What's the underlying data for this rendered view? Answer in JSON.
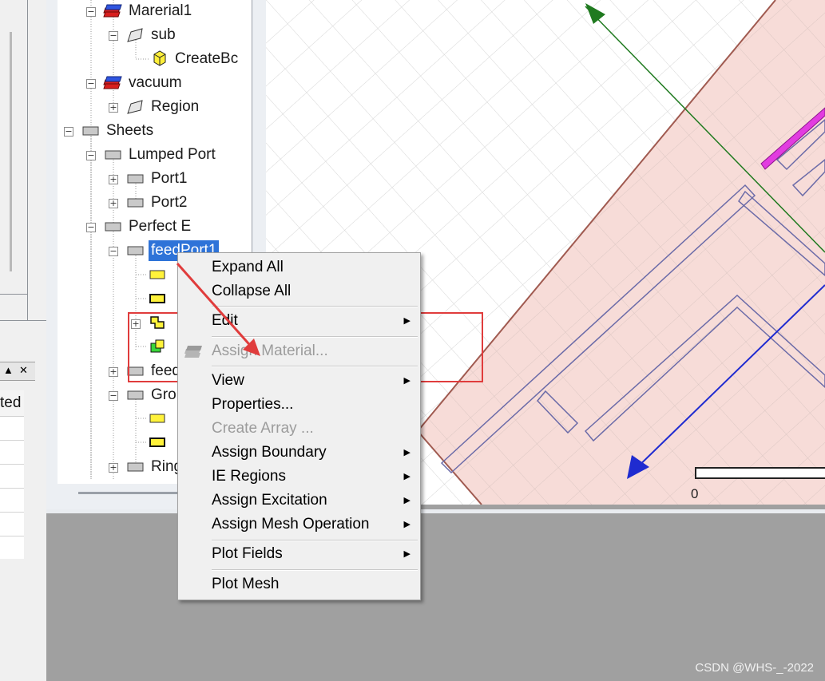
{
  "tree": {
    "items": [
      {
        "label": "Marerial1",
        "icon": "material-icon"
      },
      {
        "label": "sub",
        "icon": "object-icon"
      },
      {
        "label": "CreateBc",
        "icon": "box-icon"
      },
      {
        "label": "vacuum",
        "icon": "material-icon"
      },
      {
        "label": "Region",
        "icon": "object-icon"
      },
      {
        "label": "Sheets",
        "icon": "sheet-icon"
      },
      {
        "label": "Lumped Port",
        "icon": "sheet-icon"
      },
      {
        "label": "Port1",
        "icon": "sheet-icon"
      },
      {
        "label": "Port2",
        "icon": "sheet-icon"
      },
      {
        "label": "Perfect E",
        "icon": "sheet-icon"
      },
      {
        "label": "feedPort1",
        "icon": "sheet-icon"
      },
      {
        "label": "feed",
        "icon": "sheet-icon"
      },
      {
        "label": "Gro",
        "icon": "sheet-icon"
      },
      {
        "label": "Ring",
        "icon": "sheet-icon"
      }
    ]
  },
  "left_panel": {
    "column_header": "ted",
    "buttons": {
      "up": "▲",
      "close": "✕"
    }
  },
  "context_menu": {
    "items": [
      {
        "label": "Expand All",
        "enabled": true,
        "submenu": false
      },
      {
        "label": "Collapse All",
        "enabled": true,
        "submenu": false
      },
      {
        "label": "Edit",
        "enabled": true,
        "submenu": true
      },
      {
        "label": "Assign Material...",
        "enabled": false,
        "submenu": false
      },
      {
        "label": "View",
        "enabled": true,
        "submenu": true
      },
      {
        "label": "Properties...",
        "enabled": true,
        "submenu": false
      },
      {
        "label": "Create Array ...",
        "enabled": false,
        "submenu": false
      },
      {
        "label": "Assign Boundary",
        "enabled": true,
        "submenu": true
      },
      {
        "label": "IE Regions",
        "enabled": true,
        "submenu": true
      },
      {
        "label": "Assign Excitation",
        "enabled": true,
        "submenu": true
      },
      {
        "label": "Assign Mesh Operation",
        "enabled": true,
        "submenu": true
      },
      {
        "label": "Plot Fields",
        "enabled": true,
        "submenu": true
      },
      {
        "label": "Plot Mesh",
        "enabled": true,
        "submenu": false
      }
    ],
    "submenu_arrow": "▶"
  },
  "viewport": {
    "scale_label": "0"
  },
  "watermark": "CSDN @WHS-_-2022",
  "colors": {
    "selection": "#2e73d8",
    "annotation_red": "#e03c3c",
    "substrate_fill": "#f7dcd8",
    "axis_green": "#1f7a1f",
    "axis_blue": "#1f2bd0",
    "strip_magenta": "#e23ce0"
  }
}
